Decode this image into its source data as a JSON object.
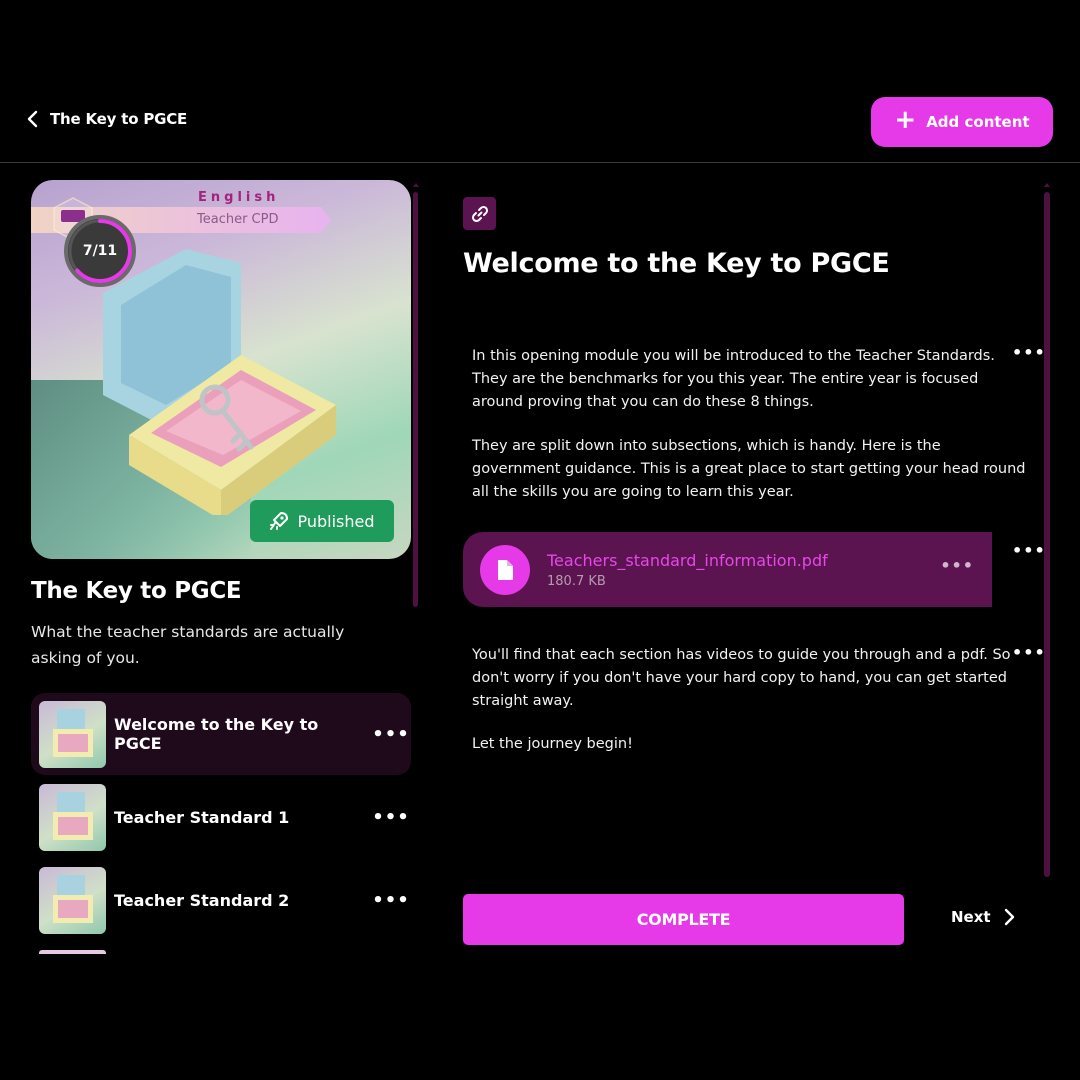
{
  "header": {
    "back_title": "The Key to PGCE",
    "add_button_label": "Add content"
  },
  "course": {
    "cover": {
      "subject": "English",
      "category": "Teacher CPD",
      "progress_text": "7/11",
      "progress_fraction": 0.636,
      "status": "Published"
    },
    "title": "The Key to PGCE",
    "description": "What the teacher standards are actually asking of you.",
    "lessons": [
      {
        "title": "Welcome to the Key to PGCE",
        "active": true
      },
      {
        "title": "Teacher Standard 1",
        "active": false
      },
      {
        "title": "Teacher Standard 2",
        "active": false
      }
    ]
  },
  "lesson": {
    "title": "Welcome to the Key to PGCE",
    "paragraphs": [
      "In this opening module you will be introduced to the Teacher Standards. They are the benchmarks for you this year. The entire year is focused around proving that you can do these 8 things.",
      "They are split down into subsections, which is handy. Here is the government guidance. This is a great place to start getting your head round all the skills you are going to learn this year.",
      "You'll find that each section has videos to guide you through and a pdf. So don't worry if you don't have your hard copy to hand, you can get started straight away.",
      "Let the journey begin!"
    ],
    "attachment": {
      "filename": "Teachers_standard_information.pdf",
      "size": "180.7 KB"
    },
    "more_label": "•••",
    "complete_label": "COMPLETE",
    "next_label": "Next"
  },
  "colors": {
    "accent": "#e63ae8",
    "published": "#1f9c5b",
    "chip": "#5c1450"
  }
}
